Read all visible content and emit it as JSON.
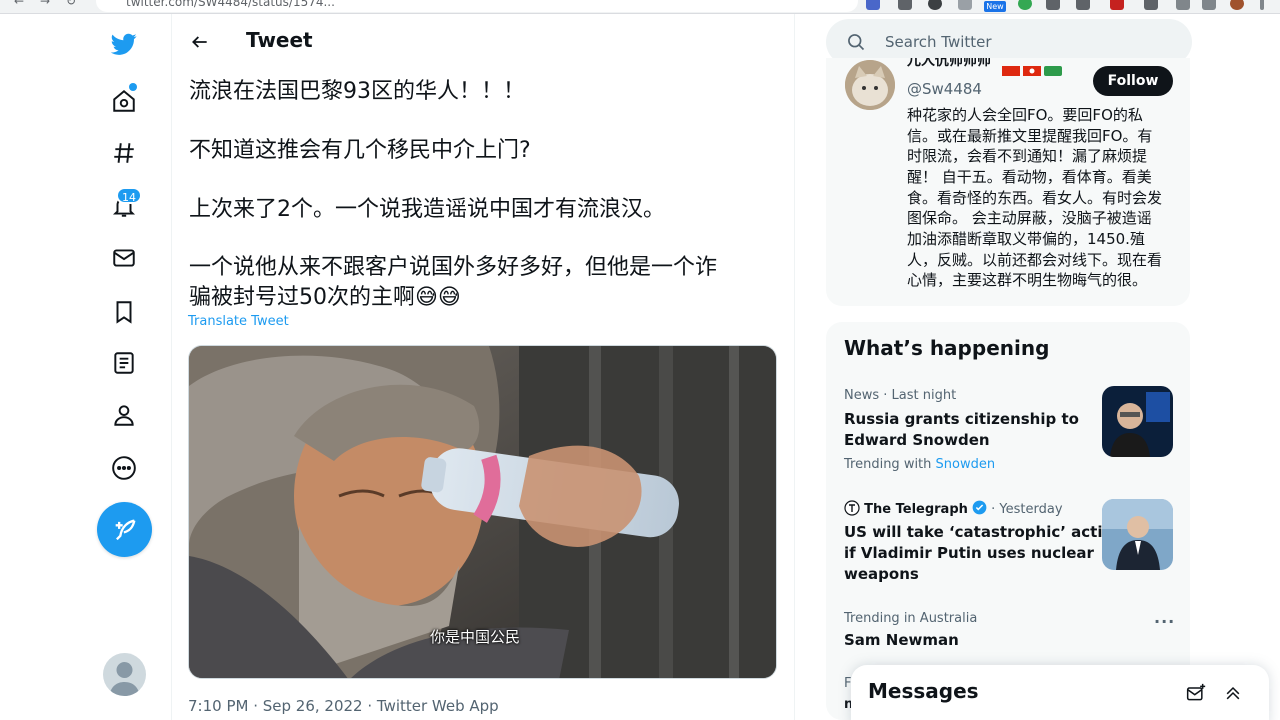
{
  "browser": {
    "url": "twitter.com/SW4484/status/1574...",
    "new_badge": "New"
  },
  "nav": {
    "notifications_count": "14",
    "items": [
      {
        "name": "home"
      },
      {
        "name": "explore"
      },
      {
        "name": "notifications"
      },
      {
        "name": "messages"
      },
      {
        "name": "bookmarks"
      },
      {
        "name": "lists"
      },
      {
        "name": "profile"
      },
      {
        "name": "more"
      }
    ]
  },
  "header": {
    "title": "Tweet"
  },
  "tweet": {
    "lines": [
      "流浪在法国巴黎93区的华人！！！",
      "不知道这推会有几个移民中介上门?",
      "上次来了2个。一个说我造谣说中国才有流浪汉。",
      "一个说他从来不跟客户说国外多好多好，但他是一个诈",
      "骗被封号过50次的主啊😅😅"
    ],
    "translate_label": "Translate Tweet",
    "video_subtitle": "你是中国公民",
    "meta": "7:10 PM · Sep 26, 2022 · Twitter Web App"
  },
  "search": {
    "placeholder": "Search Twitter"
  },
  "profile": {
    "name": "兀人伉师师师",
    "handle": "@Sw4484",
    "follow_label": "Follow",
    "bio_lines": [
      "种花家的人会全回FO。要回FO的私",
      "信。或在最新推文里提醒我回FO。有",
      "时限流，会看不到通知！漏了麻烦提",
      "醒！ 自干五。看动物，看体育。看美",
      "食。看奇怪的东西。看女人。有时会发",
      "图保命。 会主动屏蔽，没脑子被造谣",
      "加油添醋断章取义带偏的，1450.殖",
      "人，反贼。以前还都会对线下。现在看",
      "心情，主要这群不明生物晦气的很。"
    ]
  },
  "trends": {
    "title": "What’s happening",
    "items": [
      {
        "context": "News · Last night",
        "headline_lines": [
          "Russia grants citizenship to",
          "Edward Snowden"
        ],
        "trending_prefix": "Trending with",
        "trending_link": "Snowden"
      },
      {
        "source": "The Telegraph",
        "time": "· Yesterday",
        "headline_lines": [
          "US will take ‘catastrophic’ action",
          "if Vladimir Putin uses nuclear",
          "weapons"
        ]
      },
      {
        "context": "Trending in Australia",
        "headline_lines": [
          "Sam Newman"
        ],
        "more": "···"
      }
    ],
    "peek_letters": [
      "F",
      "n"
    ]
  },
  "messages": {
    "title": "Messages"
  },
  "colors": {
    "accent": "#1d9bf0",
    "text": "#0f1419",
    "muted": "#536471",
    "panel": "#f7f9f9"
  }
}
